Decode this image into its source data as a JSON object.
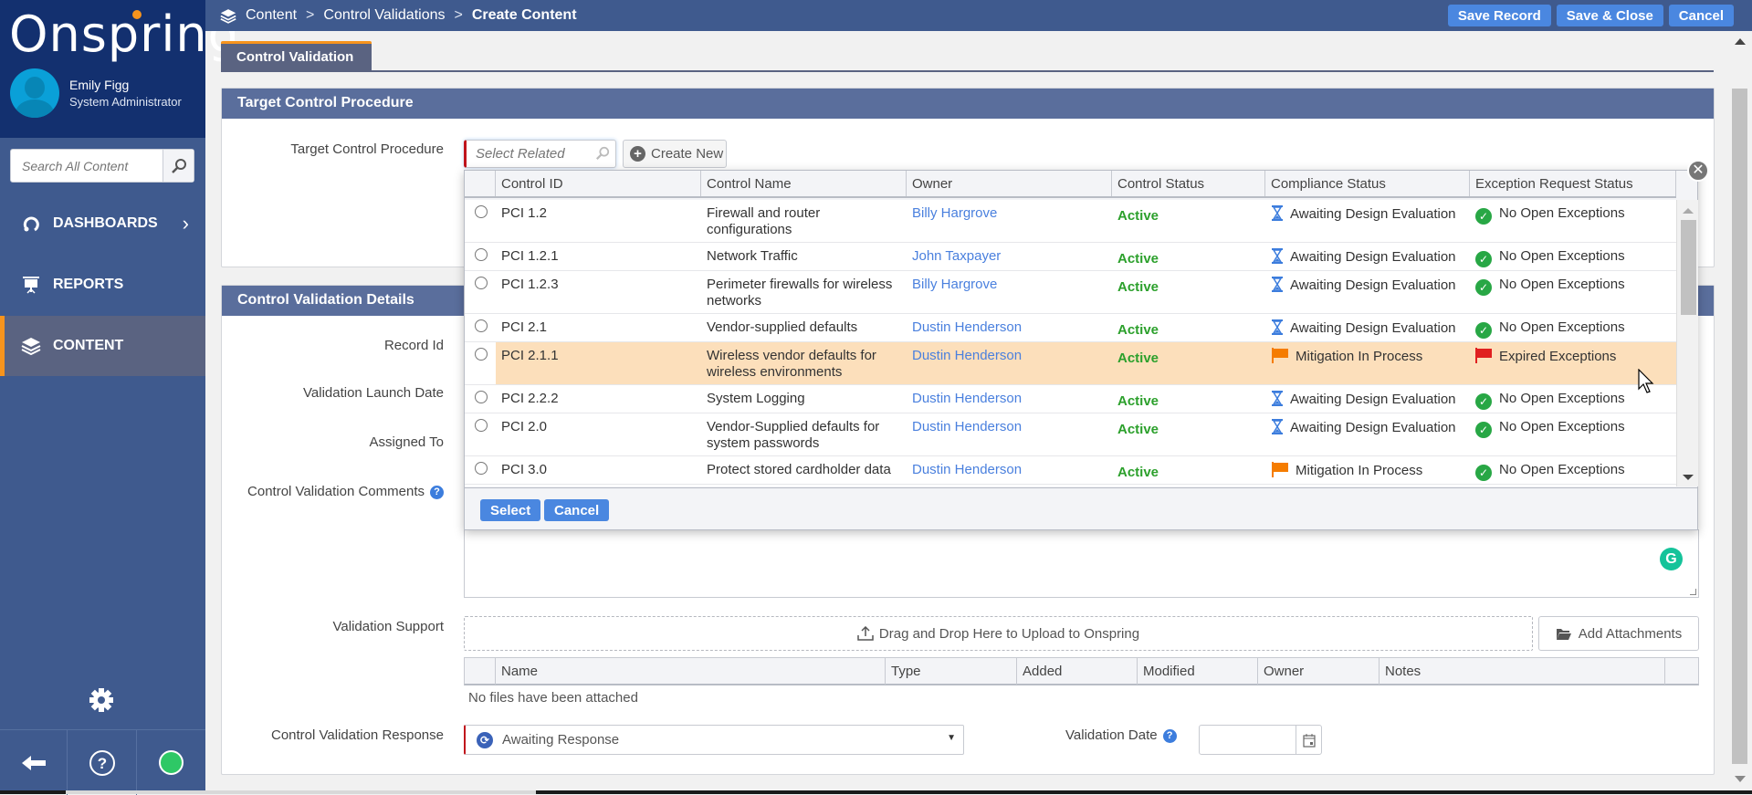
{
  "app": {
    "logo": "Onspring",
    "user_name": "Emily Figg",
    "user_role": "System Administrator",
    "search_placeholder": "Search All Content"
  },
  "sidebar": {
    "items": [
      {
        "label": "DASHBOARDS",
        "icon": "dashboard-icon",
        "has_chevron": true,
        "active": false
      },
      {
        "label": "REPORTS",
        "icon": "presentation-icon",
        "has_chevron": false,
        "active": false
      },
      {
        "label": "CONTENT",
        "icon": "layers-icon",
        "has_chevron": false,
        "active": true
      }
    ],
    "chevron": "›",
    "status_color": "#2ec866"
  },
  "header": {
    "breadcrumb": [
      "Content",
      "Control Validations",
      "Create Content"
    ],
    "separator": ">",
    "buttons": {
      "save_record": "Save Record",
      "save_close": "Save & Close",
      "cancel": "Cancel"
    }
  },
  "tab": {
    "label": "Control Validation"
  },
  "section1": {
    "title": "Target Control Procedure",
    "field_label": "Target Control Procedure",
    "select_placeholder": "Select Related",
    "create_new": "Create New"
  },
  "lookup": {
    "columns": [
      "Control ID",
      "Control Name",
      "Owner",
      "Control Status",
      "Compliance Status",
      "Exception Request Status"
    ],
    "rows": [
      {
        "id": "PCI 1.2",
        "name": "Firewall and router configurations",
        "owner": "Billy Hargrove",
        "status": "Active",
        "compliance": "Awaiting Design Evaluation",
        "compliance_icon": "hourglass",
        "exception": "No Open Exceptions",
        "exception_icon": "check"
      },
      {
        "id": "PCI 1.2.1",
        "name": "Network Traffic",
        "owner": "John Taxpayer",
        "status": "Active",
        "compliance": "Awaiting Design Evaluation",
        "compliance_icon": "hourglass",
        "exception": "No Open Exceptions",
        "exception_icon": "check"
      },
      {
        "id": "PCI 1.2.3",
        "name": "Perimeter firewalls for wireless networks",
        "owner": "Billy Hargrove",
        "status": "Active",
        "compliance": "Awaiting Design Evaluation",
        "compliance_icon": "hourglass",
        "exception": "No Open Exceptions",
        "exception_icon": "check"
      },
      {
        "id": "PCI 2.1",
        "name": "Vendor-supplied defaults",
        "owner": "Dustin Henderson",
        "status": "Active",
        "compliance": "Awaiting Design Evaluation",
        "compliance_icon": "hourglass",
        "exception": "No Open Exceptions",
        "exception_icon": "check"
      },
      {
        "id": "PCI 2.1.1",
        "name": "Wireless vendor defaults for wireless environments",
        "owner": "Dustin Henderson",
        "status": "Active",
        "compliance": "Mitigation In Process",
        "compliance_icon": "orange-flag",
        "exception": "Expired Exceptions",
        "exception_icon": "red-flag",
        "highlighted": true
      },
      {
        "id": "PCI 2.2.2",
        "name": "System Logging",
        "owner": "Dustin Henderson",
        "status": "Active",
        "compliance": "Awaiting Design Evaluation",
        "compliance_icon": "hourglass",
        "exception": "No Open Exceptions",
        "exception_icon": "check"
      },
      {
        "id": "PCI 2.0",
        "name": "Vendor-Supplied defaults for system passwords",
        "owner": "Dustin Henderson",
        "status": "Active",
        "compliance": "Awaiting Design Evaluation",
        "compliance_icon": "hourglass",
        "exception": "No Open Exceptions",
        "exception_icon": "check"
      },
      {
        "id": "PCI 3.0",
        "name": "Protect stored cardholder data",
        "owner": "Dustin Henderson",
        "status": "Active",
        "compliance": "Mitigation In Process",
        "compliance_icon": "orange-flag",
        "exception": "No Open Exceptions",
        "exception_icon": "check"
      }
    ],
    "select_label": "Select",
    "cancel_label": "Cancel"
  },
  "section2": {
    "title": "Control Validation Details",
    "labels": {
      "record_id": "Record Id",
      "launch_date": "Validation Launch Date",
      "assigned_to": "Assigned To",
      "comments": "Control Validation Comments",
      "support": "Validation Support",
      "response": "Control Validation Response",
      "validation_date": "Validation Date"
    },
    "help_glyph": "?",
    "dropzone_text": "Drag and Drop Here to Upload to Onspring",
    "add_attachments": "Add Attachments",
    "attachment_columns": [
      "Name",
      "Type",
      "Added",
      "Modified",
      "Owner",
      "Notes"
    ],
    "no_files": "No files have been attached",
    "response_value": "Awaiting Response",
    "validation_date_value": ""
  },
  "colors": {
    "brand_dark": "#13306f",
    "nav": "#3f5a8e",
    "accent": "#f7941d",
    "button": "#4a87e0",
    "active_green": "#2ca02c",
    "link": "#4a80de",
    "highlight_row": "#fcdfbb"
  }
}
